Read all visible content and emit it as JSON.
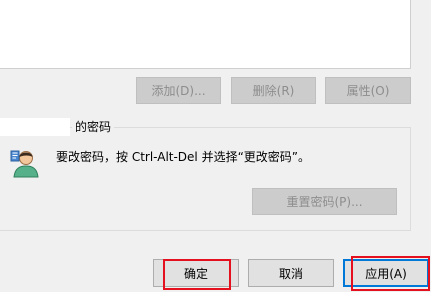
{
  "top_buttons": {
    "add": "添加(D)...",
    "remove": "删除(R)",
    "properties": "属性(O)"
  },
  "password_group": {
    "legend": "的密码",
    "message": "要改密码，按 Ctrl-Alt-Del 并选择“更改密码”。",
    "reset_button": "重置密码(P)..."
  },
  "dialog_buttons": {
    "ok": "确定",
    "cancel": "取消",
    "apply": "应用(A)"
  },
  "colors": {
    "highlight": "#e5101d",
    "window_bg": "#f0f0f0"
  },
  "icons": {
    "user": "user-icon"
  }
}
